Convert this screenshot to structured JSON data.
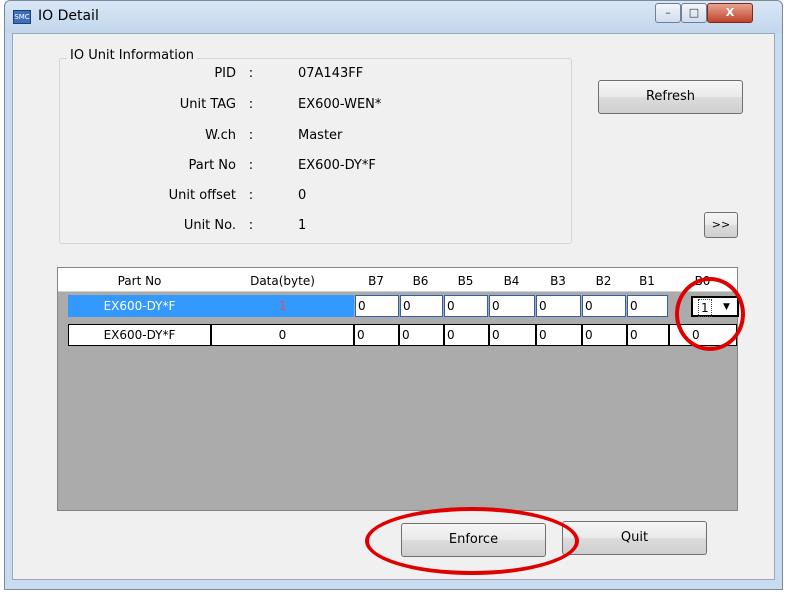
{
  "window": {
    "title": "IO Detail",
    "app_icon_text": "SMC",
    "minimize": "–",
    "maximize": "□",
    "close": "X"
  },
  "info": {
    "group_title": "IO Unit Information",
    "rows": [
      {
        "label": "PID",
        "colon": ":",
        "value": "07A143FF"
      },
      {
        "label": "Unit TAG",
        "colon": ":",
        "value": "EX600-WEN*"
      },
      {
        "label": "W.ch",
        "colon": ":",
        "value": "Master"
      },
      {
        "label": "Part No",
        "colon": ":",
        "value": "EX600-DY*F"
      },
      {
        "label": "Unit offset",
        "colon": ":",
        "value": "0"
      },
      {
        "label": "Unit No.",
        "colon": ":",
        "value": "1"
      }
    ]
  },
  "buttons": {
    "refresh": "Refresh",
    "expand": ">>",
    "enforce": "Enforce",
    "quit": "Quit"
  },
  "grid": {
    "headers": [
      "Part No",
      "Data(byte)",
      "B7",
      "B6",
      "B5",
      "B4",
      "B3",
      "B2",
      "B1",
      "B0"
    ],
    "rows": [
      {
        "part_no": "EX600-DY*F",
        "data": "1",
        "bits": [
          "0",
          "0",
          "0",
          "0",
          "0",
          "0",
          "0",
          "1"
        ]
      },
      {
        "part_no": "EX600-DY*F",
        "data": "0",
        "bits": [
          "0",
          "0",
          "0",
          "0",
          "0",
          "0",
          "0",
          "0"
        ]
      }
    ]
  },
  "colors": {
    "selection": "#3399ff",
    "highlight_ring": "#e00000"
  }
}
